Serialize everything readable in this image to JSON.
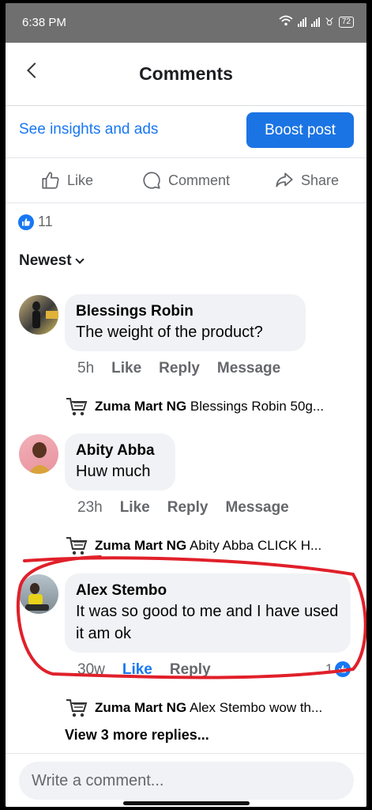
{
  "status": {
    "time": "6:38 PM",
    "battery": "72"
  },
  "header": {
    "title": "Comments"
  },
  "insights_link": "See insights and ads",
  "boost_label": "Boost post",
  "actions": {
    "like": "Like",
    "comment": "Comment",
    "share": "Share"
  },
  "reactions_count": "11",
  "sort_label": "Newest",
  "comments": [
    {
      "author": "Blessings Robin",
      "text": "The weight of the product?",
      "time": "5h",
      "like": "Like",
      "reply": "Reply",
      "message": "Message",
      "reply_preview": {
        "author": "Zuma Mart NG",
        "text": "Blessings Robin 50g..."
      }
    },
    {
      "author": "Abity Abba",
      "text": "Huw much",
      "time": "23h",
      "like": "Like",
      "reply": "Reply",
      "message": "Message",
      "reply_preview": {
        "author": "Zuma Mart NG",
        "text": "Abity Abba CLICK H..."
      }
    },
    {
      "author": "Alex Stembo",
      "text": "It was so good to me and  I have used it am ok",
      "time": "30w",
      "like": "Like",
      "reply": "Reply",
      "likes": "1",
      "reply_preview": {
        "author": "Zuma Mart NG",
        "text": "Alex Stembo wow th..."
      }
    }
  ],
  "view_more": "View 3 more replies...",
  "composer": {
    "placeholder": "Write a comment..."
  },
  "colors": {
    "accent": "#1877f2",
    "annotation": "#e0202a"
  }
}
